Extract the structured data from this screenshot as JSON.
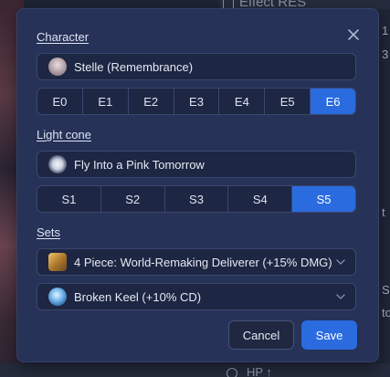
{
  "background": {
    "top_text": "Effect RES",
    "bottom_text": "HP ↑",
    "edge_chars": [
      "1",
      "3",
      "t",
      "S",
      "to"
    ]
  },
  "modal": {
    "character": {
      "label": "Character",
      "selected": "Stelle (Remembrance)",
      "eidolons": [
        "E0",
        "E1",
        "E2",
        "E3",
        "E4",
        "E5",
        "E6"
      ],
      "active_eidolon": "E6"
    },
    "light_cone": {
      "label": "Light cone",
      "selected": "Fly Into a Pink Tomorrow",
      "superimpositions": [
        "S1",
        "S2",
        "S3",
        "S4",
        "S5"
      ],
      "active_superimposition": "S5"
    },
    "sets": {
      "label": "Sets",
      "relic_set": "4 Piece: World-Remaking Deliverer (+15% DMG)",
      "ornament_set": "Broken Keel (+10% CD)"
    },
    "buttons": {
      "cancel": "Cancel",
      "save": "Save"
    },
    "colors": {
      "accent": "#2a6be0",
      "panel": "#263257",
      "field": "#1d2642"
    },
    "icons": {
      "close": "close-icon",
      "dropdown": "chevron-down-icon"
    }
  }
}
